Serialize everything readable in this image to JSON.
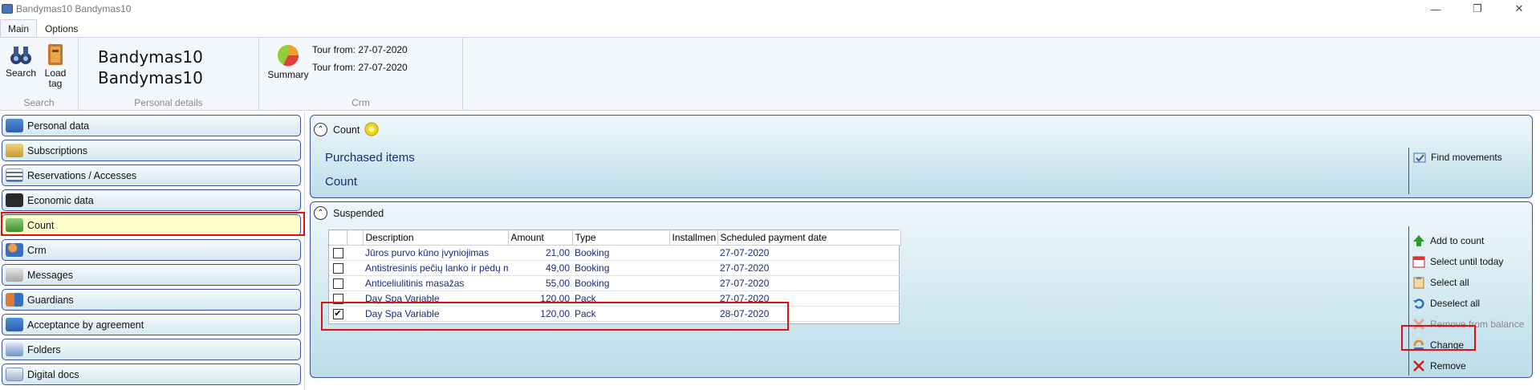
{
  "window": {
    "title": "Bandymas10 Bandymas10"
  },
  "ribbon_tabs": [
    "Main",
    "Options"
  ],
  "ribbon": {
    "search_label": "Search",
    "load_tag_label": "Load tag",
    "group_search": "Search",
    "person_line1": "Bandymas10",
    "person_line2": "Bandymas10",
    "group_personal": "Personal details",
    "summary_label": "Summary",
    "tour1": "Tour from: 27-07-2020",
    "tour2": "Tour from: 27-07-2020",
    "group_crm": "Crm"
  },
  "sidebar": {
    "items": [
      {
        "label": "Personal data",
        "icon": "id-card-icon"
      },
      {
        "label": "Subscriptions",
        "icon": "subscription-icon"
      },
      {
        "label": "Reservations / Accesses",
        "icon": "list-icon"
      },
      {
        "label": "Economic data",
        "icon": "wallet-icon"
      },
      {
        "label": "Count",
        "icon": "money-icon"
      },
      {
        "label": "Crm",
        "icon": "crm-user-icon"
      },
      {
        "label": "Messages",
        "icon": "messages-icon"
      },
      {
        "label": "Guardians",
        "icon": "guardians-icon"
      },
      {
        "label": "Acceptance by agreement",
        "icon": "agreement-icon"
      },
      {
        "label": "Folders",
        "icon": "folders-icon"
      },
      {
        "label": "Digital docs",
        "icon": "docs-icon"
      }
    ],
    "active": "Count"
  },
  "count_panel": {
    "title": "Count",
    "purchased_items": "Purchased items",
    "count_text": "Count",
    "find_movements": "Find movements"
  },
  "suspended_panel": {
    "title": "Suspended",
    "columns": [
      "",
      "Description",
      "Amount",
      "Type",
      "Installmen",
      "Scheduled payment date"
    ],
    "rows": [
      {
        "checked": false,
        "description": "Jūros purvo kūno įvyniojimas",
        "amount": "21,00",
        "type": "Booking",
        "installment": "",
        "date": "27-07-2020"
      },
      {
        "checked": false,
        "description": "Antistresinis pečių lanko ir pėdų m",
        "amount": "49,00",
        "type": "Booking",
        "installment": "",
        "date": "27-07-2020"
      },
      {
        "checked": false,
        "description": "Anticeliulitinis masažas",
        "amount": "55,00",
        "type": "Booking",
        "installment": "",
        "date": "27-07-2020"
      },
      {
        "checked": false,
        "description": "Day Spa Variable",
        "amount": "120,00",
        "type": "Pack",
        "installment": "",
        "date": "27-07-2020"
      },
      {
        "checked": true,
        "description": "Day Spa Variable",
        "amount": "120,00",
        "type": "Pack",
        "installment": "",
        "date": "28-07-2020"
      }
    ],
    "actions": [
      {
        "label": "Add to count",
        "icon": "arrow-up-green-icon",
        "enabled": true
      },
      {
        "label": "Select until today",
        "icon": "calendar-icon",
        "enabled": true
      },
      {
        "label": "Select all",
        "icon": "clipboard-icon",
        "enabled": true
      },
      {
        "label": "Deselect all",
        "icon": "undo-icon",
        "enabled": true
      },
      {
        "label": "Remove from balance",
        "icon": "remove-balance-icon",
        "enabled": false
      },
      {
        "label": "Change",
        "icon": "change-icon",
        "enabled": true
      },
      {
        "label": "Remove",
        "icon": "red-x-icon",
        "enabled": true
      }
    ]
  },
  "colors": {
    "panel_border": "#3a4fa8",
    "highlight_red": "#e01010",
    "active_item": "#ffffcc",
    "link_blue": "#1a2a7a"
  }
}
